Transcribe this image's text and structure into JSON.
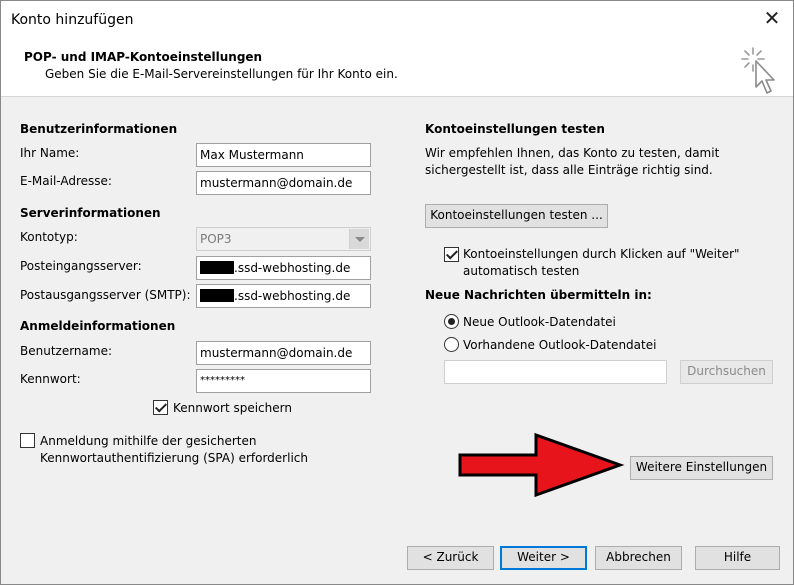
{
  "window": {
    "title": "Konto hinzufügen",
    "close_glyph": "✕"
  },
  "header": {
    "title": "POP- und IMAP-Kontoeinstellungen",
    "subtitle": "Geben Sie die E-Mail-Servereinstellungen für Ihr Konto ein.",
    "icon": "wizard-cursor-icon"
  },
  "user_info": {
    "heading": "Benutzerinformationen",
    "name_label": "Ihr Name:",
    "name_value": "Max Mustermann",
    "email_label": "E-Mail-Adresse:",
    "email_value": "mustermann@domain.de"
  },
  "server_info": {
    "heading": "Serverinformationen",
    "account_type_label": "Kontotyp:",
    "account_type_value": "POP3",
    "incoming_label": "Posteingangsserver:",
    "incoming_suffix": ".ssd-webhosting.de",
    "outgoing_label": "Postausgangsserver (SMTP):",
    "outgoing_suffix": ".ssd-webhosting.de"
  },
  "login_info": {
    "heading": "Anmeldeinformationen",
    "username_label": "Benutzername:",
    "username_value": "mustermann@domain.de",
    "password_label": "Kennwort:",
    "password_value": "*********",
    "remember_label": "Kennwort speichern",
    "remember_checked": true,
    "spa_line1": "Anmeldung mithilfe der gesicherten",
    "spa_line2": "Kennwortauthentifizierung (SPA) erforderlich",
    "spa_checked": false
  },
  "test": {
    "heading": "Kontoeinstellungen testen",
    "desc_line1": "Wir empfehlen Ihnen, das Konto zu testen, damit",
    "desc_line2": "sichergestellt ist, dass alle Einträge richtig sind.",
    "test_button": "Kontoeinstellungen testen ...",
    "auto_line1": "Kontoeinstellungen durch Klicken auf \"Weiter\"",
    "auto_line2": "automatisch testen",
    "auto_checked": true
  },
  "delivery": {
    "heading": "Neue Nachrichten übermitteln in:",
    "option_new": "Neue Outlook-Datendatei",
    "option_existing": "Vorhandene Outlook-Datendatei",
    "selected": "new",
    "existing_path": "",
    "browse_button": "Durchsuchen"
  },
  "more_settings_button": "Weitere Einstellungen",
  "annotation": {
    "arrow_color": "#e8141b",
    "icon": "red-arrow-icon"
  },
  "footer": {
    "back": "< Zurück",
    "next": "Weiter >",
    "cancel": "Abbrechen",
    "help": "Hilfe"
  }
}
